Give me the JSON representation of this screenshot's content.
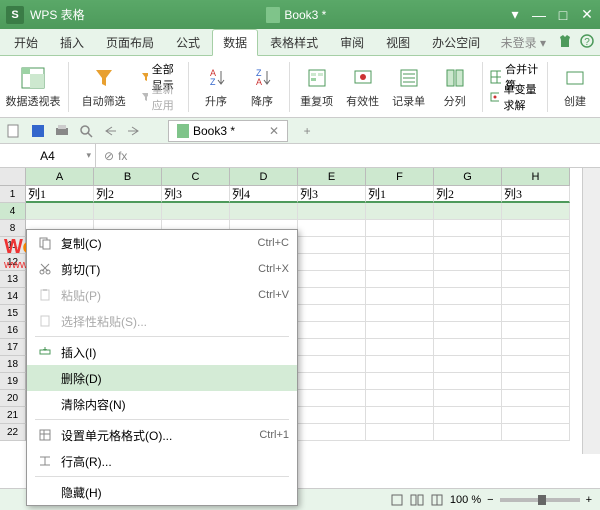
{
  "app": {
    "logo": "S",
    "name": "WPS 表格",
    "doc": "Book3 *"
  },
  "winbtns": {
    "dd": "▾",
    "min": "—",
    "max": "□",
    "close": "✕"
  },
  "menus": [
    "开始",
    "插入",
    "页面布局",
    "公式",
    "数据",
    "表格样式",
    "审阅",
    "视图",
    "办公空间"
  ],
  "active_menu_index": 4,
  "login": "未登录 ▾",
  "ribbon": {
    "pivot": "数据透视表",
    "autofilter": "自动筛选",
    "showall": "全部显示",
    "reapply": "重新应用",
    "asc": "升序",
    "desc": "降序",
    "dup": "重复项",
    "validity": "有效性",
    "record": "记录单",
    "split": "分列",
    "consolidate": "合并计算",
    "solver": "单变量求解",
    "create": "创建"
  },
  "tab": {
    "name": "Book3 *",
    "close": "✕",
    "add": "+"
  },
  "cellref": "A4",
  "fx": "fx",
  "cols": [
    "A",
    "B",
    "C",
    "D",
    "E",
    "F",
    "G",
    "H"
  ],
  "rows": [
    "1",
    "4",
    "8",
    "11",
    "12",
    "13",
    "14",
    "15",
    "16",
    "17",
    "18",
    "19",
    "20",
    "21",
    "22"
  ],
  "sel_row_index": 1,
  "data_row": [
    "列1",
    "列2",
    "列3",
    "列4",
    "列3",
    "列1",
    "列2",
    "列3"
  ],
  "ctx": {
    "copy": "复制(C)",
    "copy_k": "Ctrl+C",
    "cut": "剪切(T)",
    "cut_k": "Ctrl+X",
    "paste": "粘贴(P)",
    "paste_k": "Ctrl+V",
    "pastesp": "选择性粘贴(S)...",
    "insert": "插入(I)",
    "delete": "删除(D)",
    "clear": "清除内容(N)",
    "format": "设置单元格格式(O)...",
    "format_k": "Ctrl+1",
    "rowh": "行高(R)...",
    "hide": "隐藏(H)"
  },
  "zoom": "100 %",
  "wm": {
    "t": "Word联盟",
    "u": "www.wordlm.com"
  },
  "chart_data": null
}
